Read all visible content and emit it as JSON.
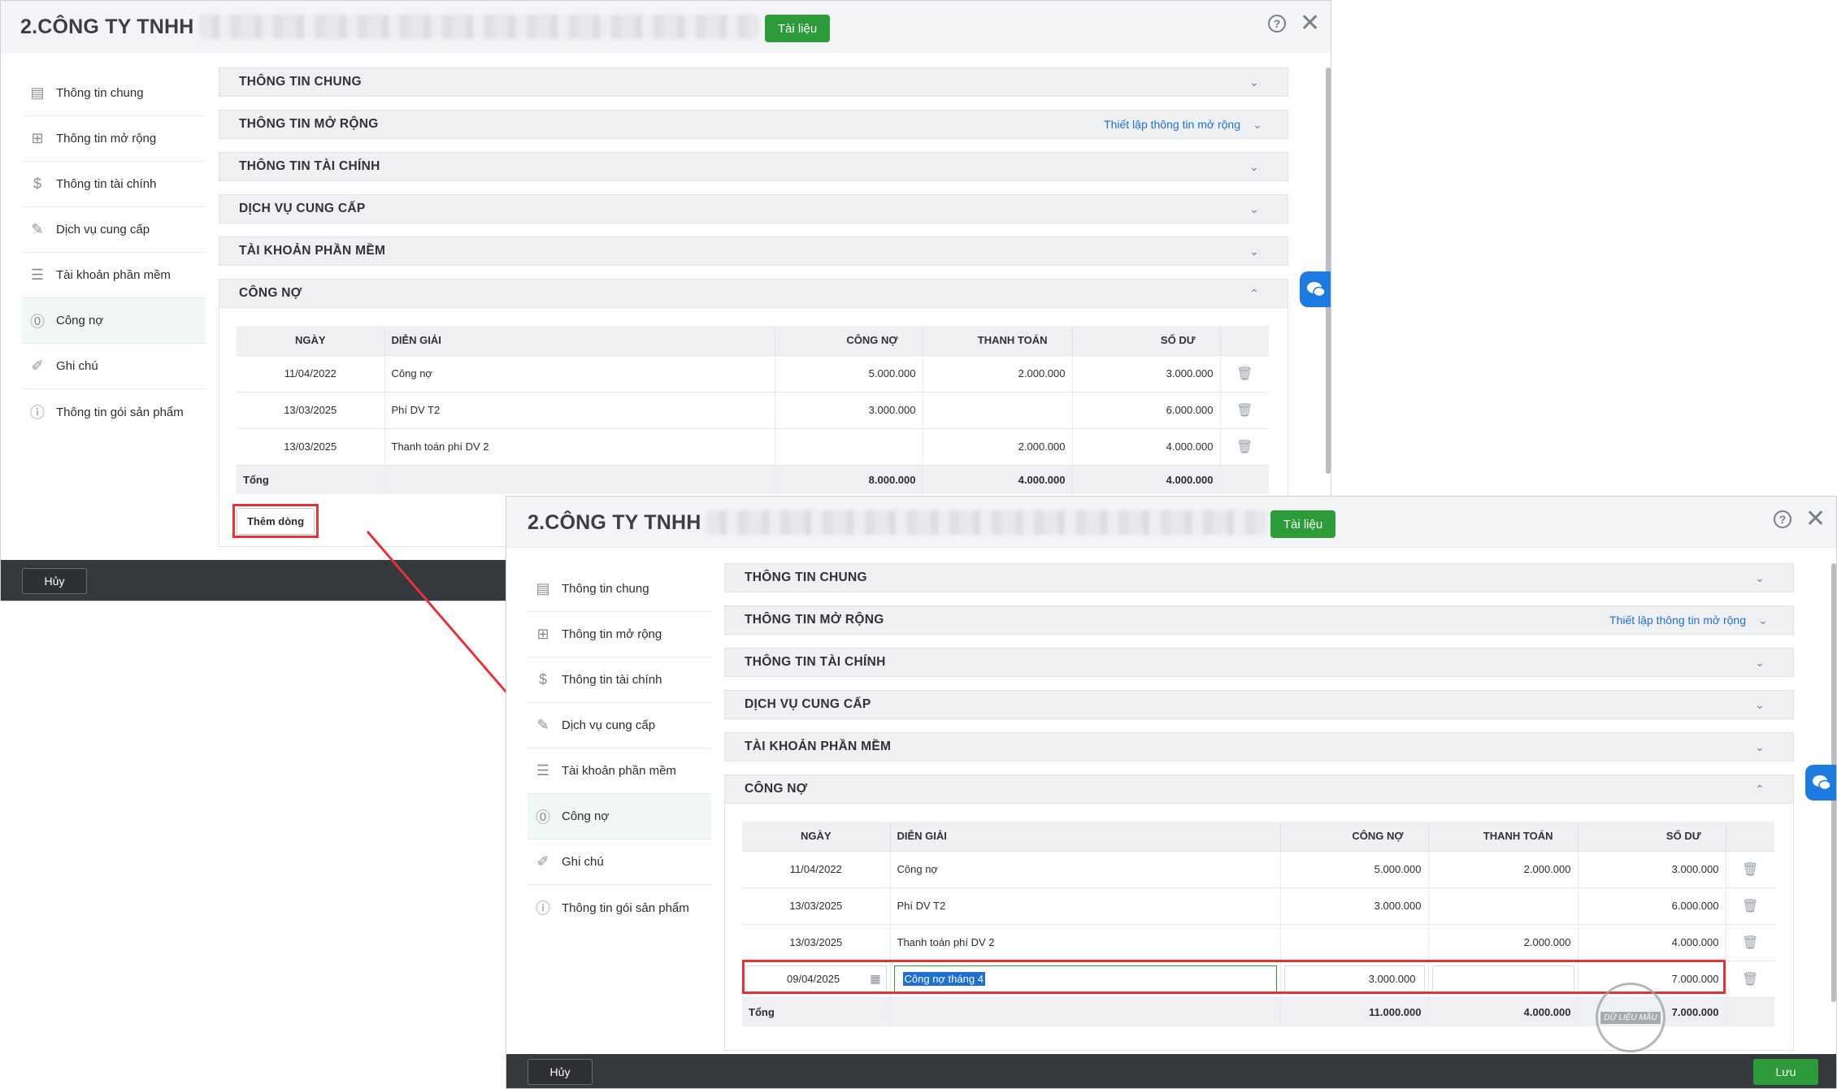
{
  "window": {
    "title": "2.CÔNG TY TNHH",
    "tai_lieu_label": "Tài liệu"
  },
  "sidebar": {
    "items": [
      {
        "label": "Thông tin chung",
        "icon": "document-icon"
      },
      {
        "label": "Thông tin mở rộng",
        "icon": "grid-plus-icon"
      },
      {
        "label": "Thông tin tài chính",
        "icon": "dollar-doc-icon"
      },
      {
        "label": "Dịch vụ cung cấp",
        "icon": "tools-icon"
      },
      {
        "label": "Tài khoản phần mềm",
        "icon": "list-icon"
      },
      {
        "label": "Công nợ",
        "icon": "coin-icon"
      },
      {
        "label": "Ghi chú",
        "icon": "note-icon"
      },
      {
        "label": "Thông tin gói sản phẩm",
        "icon": "info-icon"
      }
    ]
  },
  "sections": {
    "general": "THÔNG TIN CHUNG",
    "extended": "THÔNG TIN MỞ RỘNG",
    "extended_link": "Thiết lập thông tin mở rộng",
    "finance": "THÔNG TIN TÀI CHÍNH",
    "services": "DỊCH VỤ CUNG CẤP",
    "accounts": "TÀI KHOẢN PHẦN MỀM",
    "debt": "CÔNG NỢ"
  },
  "debt_table": {
    "headers": {
      "date": "NGÀY",
      "desc": "DIỄN GIẢI",
      "debt": "CÔNG NỢ",
      "payment": "THANH TOÁN",
      "balance": "SỐ DƯ"
    },
    "rows": [
      {
        "date": "11/04/2022",
        "desc": "Công nợ",
        "debt": "5.000.000",
        "payment": "2.000.000",
        "balance": "3.000.000"
      },
      {
        "date": "13/03/2025",
        "desc": "Phí DV T2",
        "debt": "3.000.000",
        "payment": "",
        "balance": "6.000.000"
      },
      {
        "date": "13/03/2025",
        "desc": "Thanh toán phí DV 2",
        "debt": "",
        "payment": "2.000.000",
        "balance": "4.000.000"
      }
    ],
    "total_label": "Tổng",
    "total_before": {
      "debt": "8.000.000",
      "payment": "4.000.000",
      "balance": "4.000.000"
    },
    "total_after": {
      "debt": "11.000.000",
      "payment": "4.000.000",
      "balance": "7.000.000"
    },
    "new_row": {
      "date": "09/04/2025",
      "desc": "Công nợ tháng 4",
      "debt": "3.000.000",
      "payment": "",
      "balance": "7.000.000"
    }
  },
  "buttons": {
    "add_row": "Thêm dòng",
    "cancel": "Hủy",
    "save": "Lưu"
  },
  "watermark": "DỮ LIỆU MẪU",
  "colors": {
    "accent_green": "#2e9b3b",
    "highlight_red": "#e0343a",
    "link_blue": "#1f6fd1",
    "footer_dark": "#35383d"
  }
}
